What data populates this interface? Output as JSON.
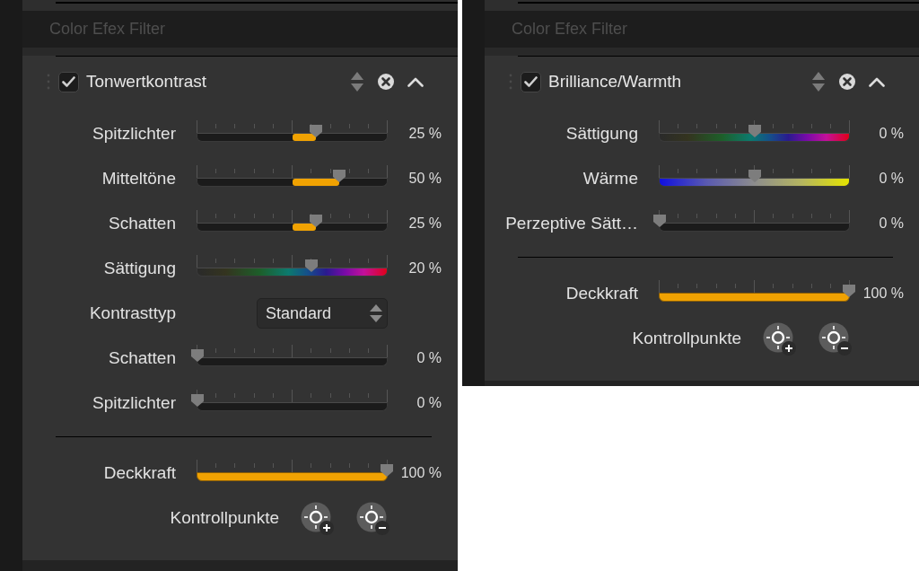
{
  "panels": [
    {
      "section_title": "Color Efex Filter",
      "filter": {
        "name": "Tonwertkontrast",
        "enabled": true,
        "expanded": true
      },
      "controls": [
        {
          "kind": "bipolar",
          "label": "Spitzlichter",
          "level": 0.625,
          "reading": "25 %"
        },
        {
          "kind": "bipolar",
          "label": "Mitteltöne",
          "level": 0.75,
          "reading": "50 %"
        },
        {
          "kind": "bipolar",
          "label": "Schatten",
          "level": 0.625,
          "reading": "25 %"
        },
        {
          "kind": "saturation",
          "label": "Sättigung",
          "level": 0.6,
          "reading": "20 %"
        },
        {
          "kind": "select",
          "label": "Kontrasttyp",
          "value": "Standard"
        },
        {
          "kind": "unipolar",
          "label": "Schatten",
          "level": 0,
          "reading": "0 %"
        },
        {
          "kind": "unipolar",
          "label": "Spitzlichter",
          "level": 0,
          "reading": "0 %"
        }
      ],
      "opacity": {
        "label": "Deckkraft",
        "level": 1,
        "reading": "100 %"
      },
      "control_points": {
        "label": "Kontrollpunkte"
      }
    },
    {
      "section_title": "Color Efex Filter",
      "filter": {
        "name": "Brilliance/Warmth",
        "enabled": true,
        "expanded": true
      },
      "controls": [
        {
          "kind": "saturation",
          "label": "Sättigung",
          "level": 0.5,
          "reading": "0 %"
        },
        {
          "kind": "warmth",
          "label": "Wärme",
          "level": 0.5,
          "reading": "0 %"
        },
        {
          "kind": "unipolar",
          "label": "Perzeptive Sätt…",
          "level": 0,
          "reading": "0 %"
        }
      ],
      "opacity": {
        "label": "Deckkraft",
        "level": 1,
        "reading": "100 %"
      },
      "control_points": {
        "label": "Kontrollpunkte"
      }
    }
  ]
}
